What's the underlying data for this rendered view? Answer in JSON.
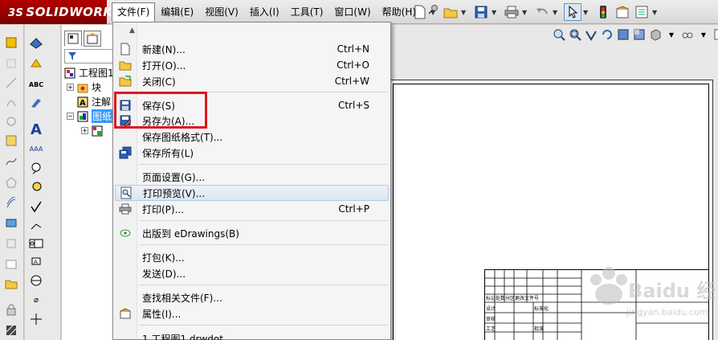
{
  "app": {
    "logo_text": "SOLIDWORKS",
    "logo_prefix": "3S"
  },
  "menubar": {
    "items": [
      "文件(F)",
      "编辑(E)",
      "视图(V)",
      "插入(I)",
      "工具(T)",
      "窗口(W)",
      "帮助(H)"
    ]
  },
  "tree": {
    "rows": [
      {
        "label": "工程图1"
      },
      {
        "label": "块"
      },
      {
        "label": "注解"
      },
      {
        "label": "图纸"
      }
    ]
  },
  "file_menu": {
    "items": [
      {
        "label": "新建(N)...",
        "shortcut": "Ctrl+N",
        "icon": "new-document-icon"
      },
      {
        "label": "打开(O)...",
        "shortcut": "Ctrl+O",
        "icon": "open-folder-icon"
      },
      {
        "label": "关闭(C)",
        "shortcut": "Ctrl+W",
        "icon": "close-folder-icon"
      },
      {
        "label": "保存(S)",
        "shortcut": "Ctrl+S",
        "icon": "save-disk-icon"
      },
      {
        "label": "另存为(A)...",
        "shortcut": "",
        "icon": "save-as-icon"
      },
      {
        "label": "保存图纸格式(T)...",
        "shortcut": "",
        "icon": ""
      },
      {
        "label": "保存所有(L)",
        "shortcut": "",
        "icon": "save-all-icon"
      },
      {
        "label": "页面设置(G)...",
        "shortcut": "",
        "icon": ""
      },
      {
        "label": "打印预览(V)...",
        "shortcut": "",
        "icon": "print-preview-icon"
      },
      {
        "label": "打印(P)...",
        "shortcut": "Ctrl+P",
        "icon": "printer-icon"
      },
      {
        "label": "出版到 eDrawings(B)",
        "shortcut": "",
        "icon": "edrawings-icon"
      },
      {
        "label": "打包(K)...",
        "shortcut": "",
        "icon": ""
      },
      {
        "label": "发送(D)...",
        "shortcut": "",
        "icon": ""
      },
      {
        "label": "查找相关文件(F)...",
        "shortcut": "",
        "icon": ""
      },
      {
        "label": "属性(I)...",
        "shortcut": "",
        "icon": "properties-icon"
      },
      {
        "label": "1 工程图1.drwdot",
        "shortcut": "",
        "icon": ""
      }
    ]
  },
  "titleblock": {
    "labels": [
      "标记",
      "处数",
      "分区",
      "更改文件号",
      "设计",
      "标准化",
      "审核",
      "工艺",
      "批准"
    ]
  },
  "watermark": {
    "text": "Baidu 经验",
    "subtext": "jingyan.baidu.com"
  },
  "colors": {
    "highlight_box": "#e0151d",
    "logo_bg": "#9a0000"
  }
}
